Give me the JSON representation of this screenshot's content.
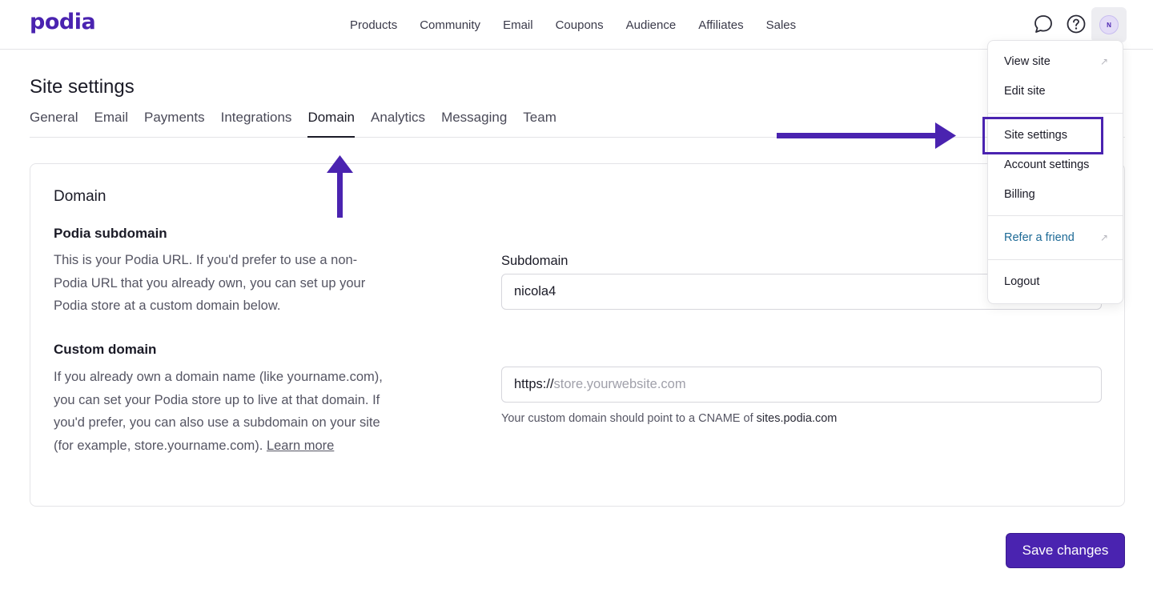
{
  "brand": {
    "logo": "podia",
    "accent": "#4a23b0"
  },
  "nav": {
    "items": [
      "Products",
      "Community",
      "Email",
      "Coupons",
      "Audience",
      "Affiliates",
      "Sales"
    ]
  },
  "header_icons": {
    "chat": "chat-bubble-icon",
    "help": "question-circle-icon",
    "avatar_initial": "N"
  },
  "page": {
    "title": "Site settings"
  },
  "tabs": {
    "items": [
      "General",
      "Email",
      "Payments",
      "Integrations",
      "Domain",
      "Analytics",
      "Messaging",
      "Team"
    ],
    "active": "Domain"
  },
  "domain_card": {
    "title": "Domain",
    "subdomain_section": {
      "heading": "Podia subdomain",
      "description": "This is your Podia URL. If you'd prefer to use a non-Podia URL that you already own, you can set up your Podia store at a custom domain below.",
      "field_label": "Subdomain",
      "value": "nicola4"
    },
    "custom_section": {
      "heading": "Custom domain",
      "description": "If you already own a domain name (like yourname.com), you can set your Podia store up to live at that domain. If you'd prefer, you can also use a subdomain on your site (for example, store.yourname.com).",
      "learn_more": "Learn more",
      "prefix": "https://",
      "placeholder": "store.yourwebsite.com",
      "hint": "Your custom domain should point to a CNAME of",
      "hint_domain": "sites.podia.com"
    }
  },
  "save_button": "Save changes",
  "dropdown": {
    "view_site": "View site",
    "edit_site": "Edit site",
    "site_settings": "Site settings",
    "account_settings": "Account settings",
    "billing": "Billing",
    "refer": "Refer a friend",
    "logout": "Logout",
    "external_icon": "↗"
  }
}
